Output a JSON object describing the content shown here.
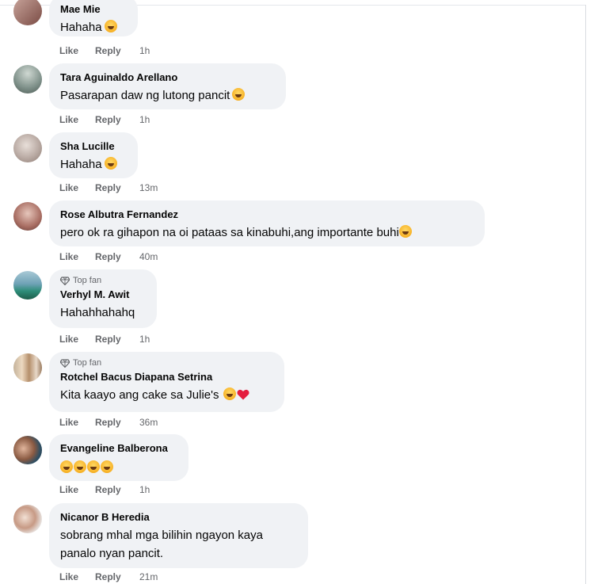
{
  "comments": [
    {
      "author": "Mae Mie",
      "top_fan": false,
      "text": "Hahaha",
      "emoji": [
        "laugh"
      ],
      "like": "Like",
      "reply": "Reply",
      "time": "1h"
    },
    {
      "author": "Tara Aguinaldo Arellano",
      "top_fan": false,
      "text": "Pasarapan daw ng lutong pancit",
      "emoji": [
        "smile"
      ],
      "like": "Like",
      "reply": "Reply",
      "time": "1h"
    },
    {
      "author": "Sha Lucille",
      "top_fan": false,
      "text": "Hahaha",
      "emoji": [
        "laugh"
      ],
      "like": "Like",
      "reply": "Reply",
      "time": "13m"
    },
    {
      "author": "Rose Albutra Fernandez",
      "top_fan": false,
      "text": "pero ok ra gihapon na oi pataas sa kinabuhi,ang importante buhi",
      "emoji": [
        "rofl"
      ],
      "like": "Like",
      "reply": "Reply",
      "time": "40m"
    },
    {
      "author": "Verhyl M. Awit",
      "top_fan": true,
      "badge_label": "Top fan",
      "text": "Hahahhahahq",
      "emoji": [],
      "like": "Like",
      "reply": "Reply",
      "time": "1h"
    },
    {
      "author": "Rotchel Bacus Diapana Setrina",
      "top_fan": true,
      "badge_label": "Top fan",
      "text": "Kita kaayo ang cake sa Julie's",
      "emoji": [
        "kiss",
        "heart"
      ],
      "like": "Like",
      "reply": "Reply",
      "time": "36m"
    },
    {
      "author": "Evangeline Balberona",
      "top_fan": false,
      "text": "",
      "emoji": [
        "laugh",
        "laugh",
        "rofl",
        "rofl"
      ],
      "like": "Like",
      "reply": "Reply",
      "time": "1h"
    },
    {
      "author": "Nicanor B Heredia",
      "top_fan": false,
      "text_lines": [
        "sobrang mhal mga bilihin ngayon kaya",
        "panalo nyan pancit."
      ],
      "emoji": [],
      "like": "Like",
      "reply": "Reply",
      "time": "21m"
    }
  ],
  "colors": {
    "bubble": "#f0f2f5",
    "meta": "#65676b",
    "text": "#050505",
    "heart": "#e41e3f"
  }
}
